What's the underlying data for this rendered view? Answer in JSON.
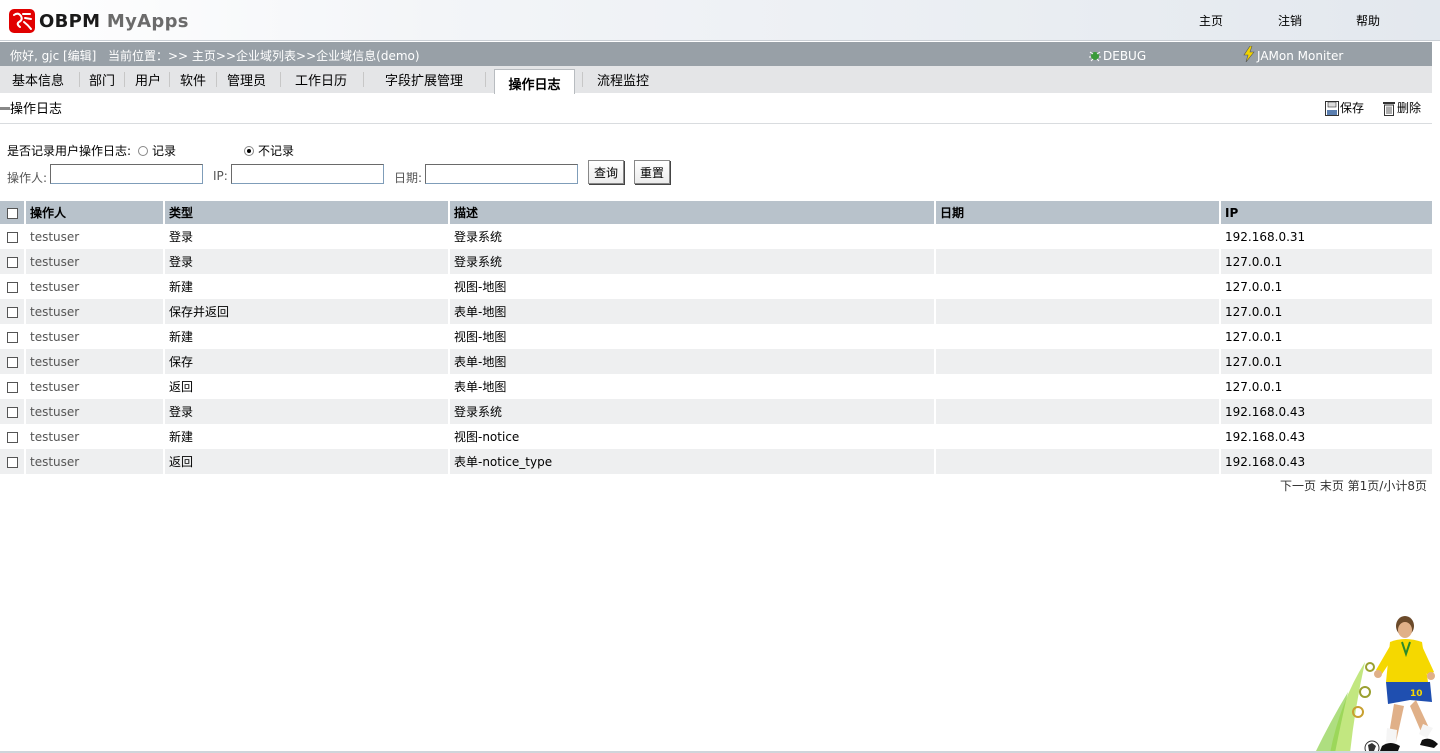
{
  "header": {
    "logo_text_a": "OBPM",
    "logo_text_b": "MyApps",
    "nav": {
      "home": "主页",
      "logout": "注销",
      "help": "帮助"
    }
  },
  "infobar": {
    "greeting": "你好, gjc [编辑]",
    "location": "当前位置：>> 主页>>企业域列表>>企业域信息(demo)",
    "debug": "DEBUG",
    "jamon": "JAMon Moniter"
  },
  "tabs": [
    "基本信息",
    "部门",
    "用户",
    "软件",
    "管理员",
    "工作日历",
    "字段扩展管理",
    "操作日志",
    "流程监控"
  ],
  "active_tab": "操作日志",
  "section": {
    "title": "操作日志",
    "save_label": "保存",
    "delete_label": "删除"
  },
  "form": {
    "record_question": "是否记录用户操作日志:",
    "record_option": "记录",
    "norecord_option": "不记录",
    "selected": "不记录",
    "operator_label": "操作人:",
    "ip_label": "IP:",
    "date_label": "日期:",
    "operator_value": "",
    "ip_value": "",
    "date_value": "",
    "query_button": "查询",
    "reset_button": "重置"
  },
  "table": {
    "columns": [
      "操作人",
      "类型",
      "描述",
      "日期",
      "IP"
    ],
    "rows": [
      {
        "user": "testuser",
        "type": "登录",
        "desc": "登录系统",
        "date": "",
        "ip": "192.168.0.31"
      },
      {
        "user": "testuser",
        "type": "登录",
        "desc": "登录系统",
        "date": "",
        "ip": "127.0.0.1"
      },
      {
        "user": "testuser",
        "type": "新建",
        "desc": "视图-地图",
        "date": "",
        "ip": "127.0.0.1"
      },
      {
        "user": "testuser",
        "type": "保存并返回",
        "desc": "表单-地图",
        "date": "",
        "ip": "127.0.0.1"
      },
      {
        "user": "testuser",
        "type": "新建",
        "desc": "视图-地图",
        "date": "",
        "ip": "127.0.0.1"
      },
      {
        "user": "testuser",
        "type": "保存",
        "desc": "表单-地图",
        "date": "",
        "ip": "127.0.0.1"
      },
      {
        "user": "testuser",
        "type": "返回",
        "desc": "表单-地图",
        "date": "",
        "ip": "127.0.0.1"
      },
      {
        "user": "testuser",
        "type": "登录",
        "desc": "登录系统",
        "date": "",
        "ip": "192.168.0.43"
      },
      {
        "user": "testuser",
        "type": "新建",
        "desc": "视图-notice",
        "date": "",
        "ip": "192.168.0.43"
      },
      {
        "user": "testuser",
        "type": "返回",
        "desc": "表单-notice_type",
        "date": "",
        "ip": "192.168.0.43"
      }
    ]
  },
  "pager": {
    "next": "下一页",
    "last": "末页",
    "info": "第1页/小计8页"
  },
  "colors": {
    "infobar": "#98a0a7",
    "tabbar": "#e4e5e7",
    "grid_header": "#b8c2cb",
    "row_alt": "#eeeff0"
  }
}
